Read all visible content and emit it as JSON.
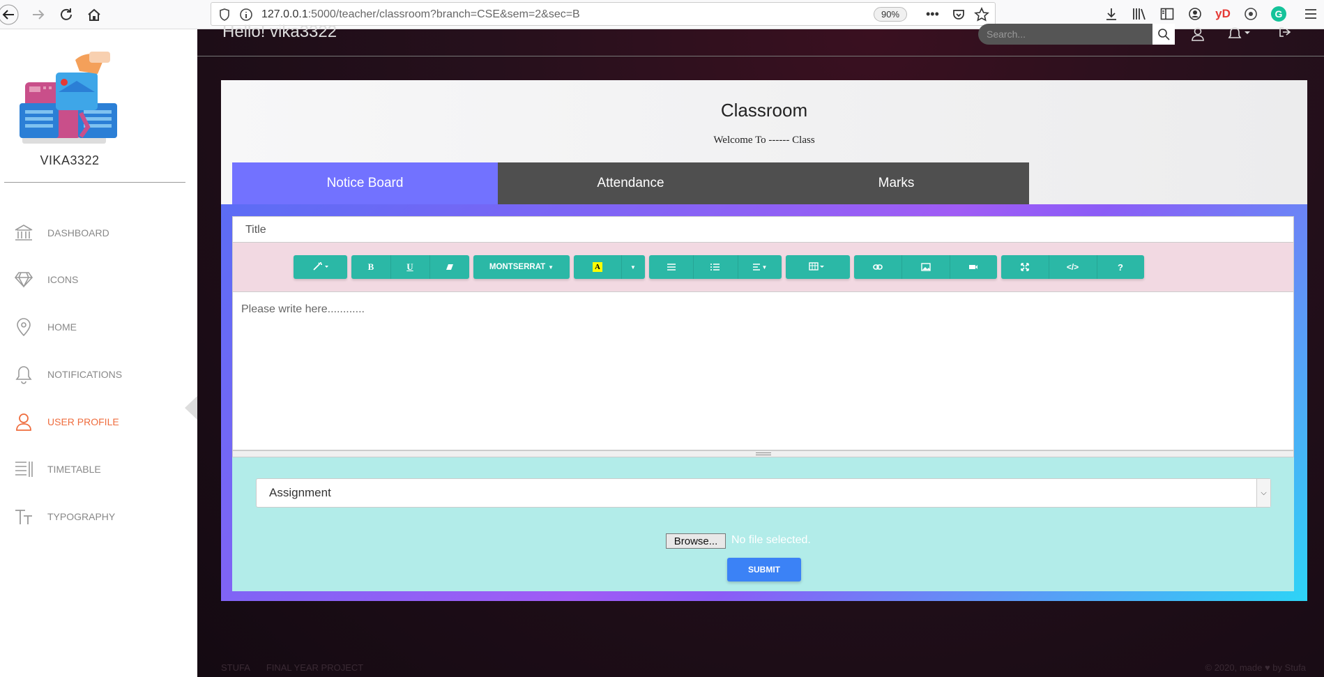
{
  "browser": {
    "url_host": "127.0.0.1",
    "url_rest": ":5000/teacher/classroom?branch=CSE&sem=2&sec=B",
    "zoom": "90%",
    "ext_yd": "yD",
    "ext_g": "G"
  },
  "sidebar": {
    "username": "VIKA3322",
    "items": [
      {
        "label": "DASHBOARD",
        "icon": "bank-icon"
      },
      {
        "label": "ICONS",
        "icon": "diamond-icon"
      },
      {
        "label": "HOME",
        "icon": "map-pin-icon"
      },
      {
        "label": "NOTIFICATIONS",
        "icon": "bell-icon"
      },
      {
        "label": "USER PROFILE",
        "icon": "user-icon"
      },
      {
        "label": "TIMETABLE",
        "icon": "bars-icon"
      },
      {
        "label": "TYPOGRAPHY",
        "icon": "typography-icon"
      }
    ],
    "active_index": 4
  },
  "header": {
    "greeting": "Hello! vika3322",
    "search_placeholder": "Search..."
  },
  "classroom": {
    "title": "Classroom",
    "subtitle": "Welcome To ------ Class",
    "tabs": [
      "Notice Board",
      "Attendance",
      "Marks"
    ],
    "active_tab": 0,
    "title_placeholder": "Title",
    "editor_placeholder": "Please write here............",
    "font_label": "MONTSERRAT",
    "type_select_value": "Assignment",
    "browse_label": "Browse...",
    "file_status": "No file selected.",
    "submit_label": "SUBMIT"
  },
  "footer": {
    "left_1": "STUFA",
    "left_2": "FINAL YEAR PROJECT",
    "right": "© 2020, made ♥ by Stufa"
  },
  "colors": {
    "accent_active": "#ef6c3d",
    "tab_active": "#7272ff",
    "toolbar_btn": "#2bb8a6",
    "submit": "#3b82f6"
  }
}
